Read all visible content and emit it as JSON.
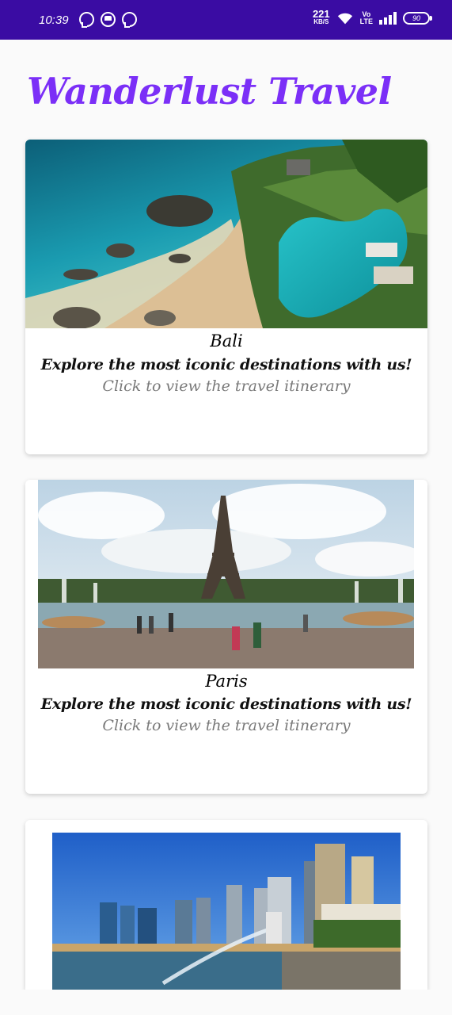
{
  "status_bar": {
    "time": "10:39",
    "net_speed": "221",
    "net_unit": "KB/S",
    "volte_top": "Vo",
    "volte_bottom": "LTE",
    "battery": "90",
    "icons": [
      "whatsapp-icon",
      "message-icon",
      "whatsapp-icon",
      "wifi-icon",
      "signal-icon",
      "battery-icon"
    ]
  },
  "app": {
    "title": "Wanderlust Travel",
    "accent_color": "#7b2ff7",
    "status_bar_color": "#3a0ca3"
  },
  "destinations": [
    {
      "name": "Bali",
      "tagline": "Explore the most iconic destinations with us!",
      "link_text": "Click to view the travel itinerary",
      "image": "bali-beach-resort-photo"
    },
    {
      "name": "Paris",
      "tagline": "Explore the most iconic destinations with us!",
      "link_text": "Click to view the travel itinerary",
      "image": "eiffel-tower-photo"
    },
    {
      "name": "",
      "image": "singapore-skyline-photo"
    }
  ]
}
